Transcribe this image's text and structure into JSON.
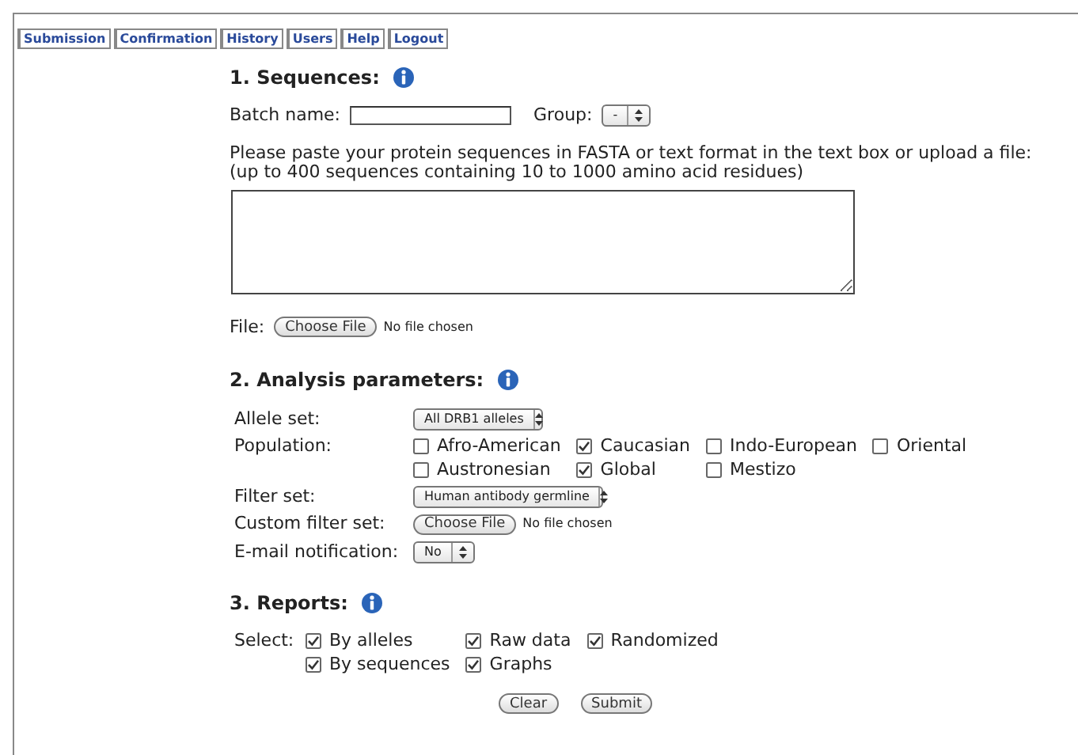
{
  "nav": [
    {
      "label": "Submission"
    },
    {
      "label": "Confirmation"
    },
    {
      "label": "History"
    },
    {
      "label": "Users"
    },
    {
      "label": "Help"
    },
    {
      "label": "Logout"
    }
  ],
  "sequences": {
    "title": "1. Sequences:",
    "batch_label": "Batch name:",
    "group_label": "Group:",
    "group_value": "-",
    "instructions": "Please paste your protein sequences in FASTA or text format in the text box or upload a file:\n(up to 400 sequences containing 10 to 1000 amino acid residues)",
    "file_label": "File:",
    "file_button": "Choose File",
    "file_status": "No file chosen"
  },
  "analysis": {
    "title": "2. Analysis parameters:",
    "allele_label": "Allele set:",
    "allele_value": "All DRB1 alleles",
    "population_label": "Population:",
    "populations": [
      {
        "label": "Afro-American",
        "checked": false
      },
      {
        "label": "Caucasian",
        "checked": true
      },
      {
        "label": "Indo-European",
        "checked": false
      },
      {
        "label": "Oriental",
        "checked": false
      },
      {
        "label": "Austronesian",
        "checked": false
      },
      {
        "label": "Global",
        "checked": true
      },
      {
        "label": "Mestizo",
        "checked": false
      }
    ],
    "filter_label": "Filter set:",
    "filter_value": "Human antibody germline",
    "custom_label": "Custom filter set:",
    "custom_button": "Choose File",
    "custom_status": "No file chosen",
    "email_label": "E-mail notification:",
    "email_value": "No"
  },
  "reports": {
    "title": "3. Reports:",
    "select_label": "Select:",
    "options": [
      {
        "label": "By alleles",
        "checked": true
      },
      {
        "label": "Raw data",
        "checked": true
      },
      {
        "label": "Randomized",
        "checked": true
      },
      {
        "label": "By sequences",
        "checked": true
      },
      {
        "label": "Graphs",
        "checked": true
      }
    ]
  },
  "buttons": [
    "Clear",
    "Submit"
  ]
}
